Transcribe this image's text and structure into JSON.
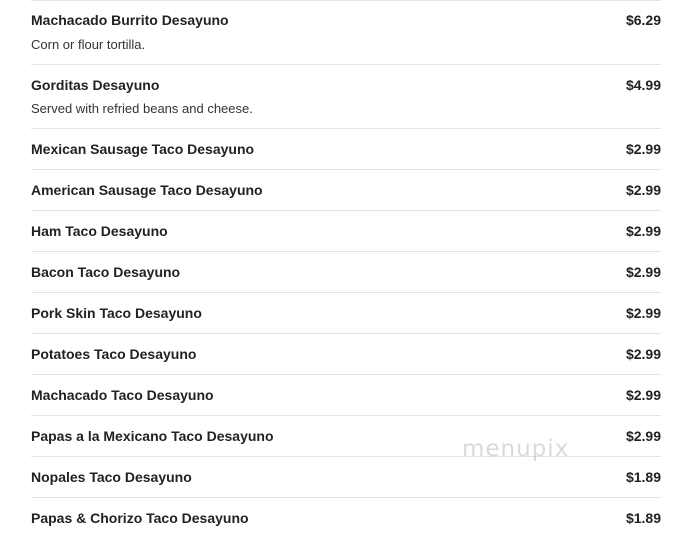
{
  "menu": {
    "items": [
      {
        "name": "Machacado Burrito Desayuno",
        "description": "Corn or flour tortilla.",
        "price": "$6.29"
      },
      {
        "name": "Gorditas Desayuno",
        "description": "Served with refried beans and cheese.",
        "price": "$4.99"
      },
      {
        "name": "Mexican Sausage Taco Desayuno",
        "description": "",
        "price": "$2.99"
      },
      {
        "name": "American Sausage Taco Desayuno",
        "description": "",
        "price": "$2.99"
      },
      {
        "name": "Ham Taco Desayuno",
        "description": "",
        "price": "$2.99"
      },
      {
        "name": "Bacon Taco Desayuno",
        "description": "",
        "price": "$2.99"
      },
      {
        "name": "Pork Skin Taco Desayuno",
        "description": "",
        "price": "$2.99"
      },
      {
        "name": "Potatoes Taco Desayuno",
        "description": "",
        "price": "$2.99"
      },
      {
        "name": "Machacado Taco Desayuno",
        "description": "",
        "price": "$2.99"
      },
      {
        "name": "Papas a la Mexicano Taco Desayuno",
        "description": "",
        "price": "$2.99"
      },
      {
        "name": "Nopales Taco Desayuno",
        "description": "",
        "price": "$1.89"
      },
      {
        "name": "Papas & Chorizo Taco Desayuno",
        "description": "",
        "price": "$1.89"
      }
    ]
  },
  "watermark": "menupix"
}
